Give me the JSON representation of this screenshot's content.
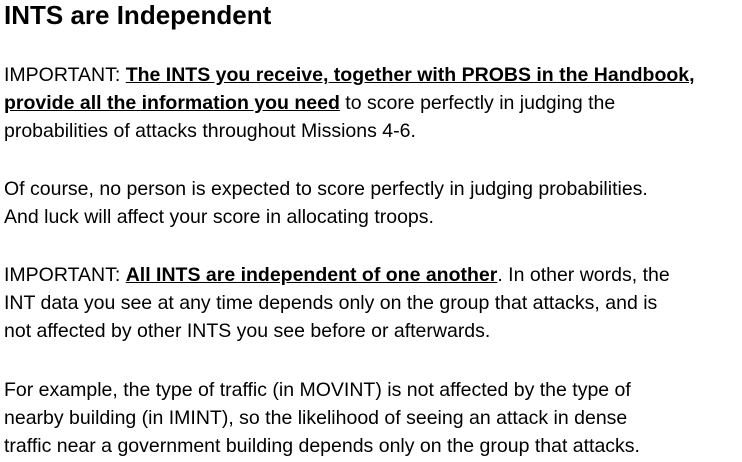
{
  "title": "INTS are Independent",
  "p1": {
    "l1_prefix": "IMPORTANT: ",
    "l1_emph": "The INTS you receive, together with PROBS in the Handbook,",
    "l2_emph": "provide all the information you need",
    "l2_rest": " to score perfectly in judging the",
    "l3": "probabilities of attacks throughout Missions 4-6."
  },
  "p2": {
    "l1": "Of course, no person is expected to score perfectly in judging probabilities.",
    "l2": "And luck will affect your score in allocating troops."
  },
  "p3": {
    "l1_prefix": "IMPORTANT: ",
    "l1_emph": "All INTS are independent of one another",
    "l1_rest": ". In other words, the",
    "l2": "INT data you see at any time depends only on the group that attacks, and is",
    "l3": "not affected by other INTS you see before or afterwards."
  },
  "p4": {
    "l1": "For example, the type of traffic (in MOVINT) is not affected by the type of",
    "l2": "nearby building (in IMINT), so the likelihood of seeing an attack in dense",
    "l3": "traffic near a government building depends only on the group that attacks."
  }
}
